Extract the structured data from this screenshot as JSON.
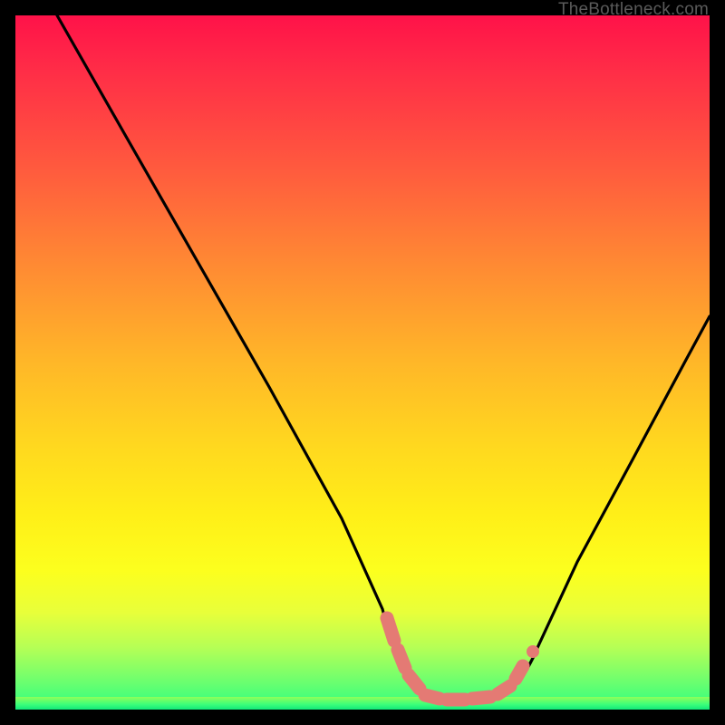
{
  "watermark": "TheBottleneck.com",
  "chart_data": {
    "type": "line",
    "title": "",
    "xlabel": "",
    "ylabel": "",
    "xlim": [
      0,
      100
    ],
    "ylim": [
      0,
      100
    ],
    "series": [
      {
        "name": "bottleneck-curve",
        "x": [
          0,
          10,
          20,
          30,
          40,
          48,
          52,
          56,
          60,
          64,
          68,
          72,
          80,
          90,
          100
        ],
        "values": [
          100,
          83,
          66,
          49,
          32,
          15,
          7,
          2,
          0,
          0,
          0,
          2,
          12,
          30,
          50
        ]
      }
    ],
    "annotations": [
      {
        "name": "valley-marker",
        "x_range": [
          53,
          73
        ],
        "y": 1,
        "style": "salmon-band"
      }
    ],
    "gradient_stops": [
      {
        "pos": 0,
        "color": "#ff1249"
      },
      {
        "pos": 50,
        "color": "#ffb728"
      },
      {
        "pos": 80,
        "color": "#fcff1e"
      },
      {
        "pos": 100,
        "color": "#11e87a"
      }
    ]
  }
}
